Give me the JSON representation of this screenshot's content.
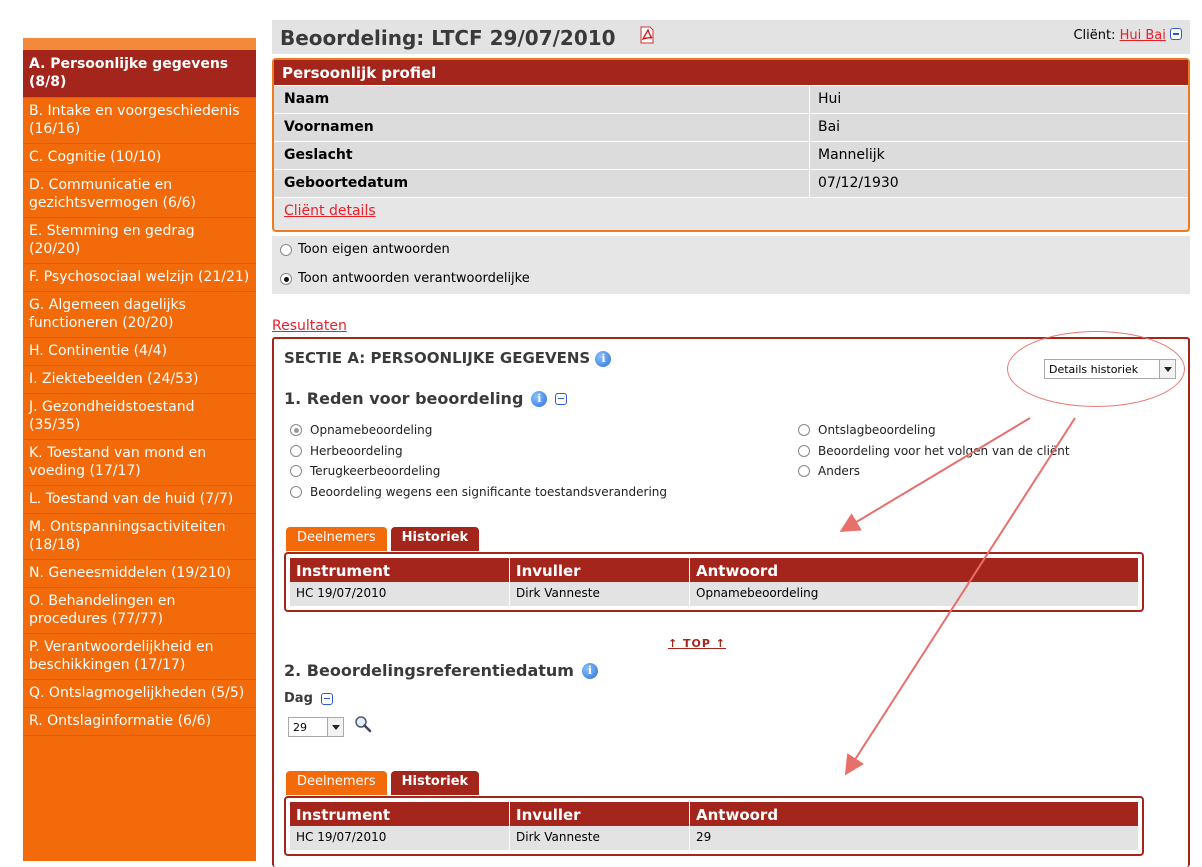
{
  "sidebar": {
    "items": [
      {
        "label": "A. Persoonlijke gegevens (8/8)",
        "active": true
      },
      {
        "label": "B. Intake en voorgeschiedenis (16/16)"
      },
      {
        "label": "C. Cognitie (10/10)"
      },
      {
        "label": "D. Communicatie en gezichtsvermogen (6/6)"
      },
      {
        "label": "E. Stemming en gedrag (20/20)"
      },
      {
        "label": "F. Psychosociaal welzijn (21/21)"
      },
      {
        "label": "G. Algemeen dagelijks functioneren (20/20)"
      },
      {
        "label": "H. Continentie (4/4)"
      },
      {
        "label": "I. Ziektebeelden (24/53)"
      },
      {
        "label": "J. Gezondheidstoestand (35/35)"
      },
      {
        "label": "K. Toestand van mond en voeding (17/17)"
      },
      {
        "label": "L. Toestand van de huid (7/7)"
      },
      {
        "label": "M. Ontspanningsactiviteiten (18/18)"
      },
      {
        "label": "N. Geneesmiddelen (19/210)"
      },
      {
        "label": "O. Behandelingen en procedures (77/77)"
      },
      {
        "label": "P. Verantwoordelijkheid en beschikkingen (17/17)"
      },
      {
        "label": "Q. Ontslagmogelijkheden (5/5)"
      },
      {
        "label": "R. Ontslaginformatie (6/6)"
      }
    ]
  },
  "header": {
    "title": "Beoordeling: LTCF 29/07/2010",
    "client_label": "Cliënt:",
    "client_name": "Hui Bai"
  },
  "profile": {
    "heading": "Persoonlijk profiel",
    "rows": [
      {
        "key": "Naam",
        "value": "Hui"
      },
      {
        "key": "Voornamen",
        "value": "Bai"
      },
      {
        "key": "Geslacht",
        "value": "Mannelijk"
      },
      {
        "key": "Geboortedatum",
        "value": "07/12/1930"
      }
    ],
    "details_link": "Cliënt details"
  },
  "view_options": {
    "own": "Toon eigen antwoorden",
    "responsible": "Toon antwoorden verantwoordelijke",
    "selected": "responsible"
  },
  "results_link": "Resultaten",
  "section": {
    "title": "SECTIE A: PERSOONLIJKE GEGEVENS",
    "details_select": "Details historiek",
    "q1": {
      "title": "1. Reden voor beoordeling",
      "options_left": [
        "Opnamebeoordeling",
        "Herbeoordeling",
        "Terugkeerbeoordeling",
        "Beoordeling wegens een significante toestandsverandering"
      ],
      "options_right": [
        "Ontslagbeoordeling",
        "Beoordeling voor het volgen van de cliënt",
        "Anders"
      ],
      "selected": "Opnamebeoordeling"
    },
    "tabs": {
      "participants": "Deelnemers",
      "history": "Historiek"
    },
    "table_headers": {
      "instrument": "Instrument",
      "filler": "Invuller",
      "answer": "Antwoord"
    },
    "q1_row": {
      "instrument": "HC 19/07/2010",
      "filler": "Dirk Vanneste",
      "answer": "Opnamebeoordeling"
    },
    "top_link": "↑ TOP ↑",
    "q2": {
      "title": "2. Beoordelingsreferentiedatum",
      "day_label": "Dag",
      "day_value": "29"
    },
    "q2_row": {
      "instrument": "HC 19/07/2010",
      "filler": "Dirk Vanneste",
      "answer": "29"
    }
  },
  "colors": {
    "orange": "#f26a0a",
    "dark_red": "#a4251b",
    "link_red": "#e8202a",
    "annotation": "#e8706a"
  }
}
